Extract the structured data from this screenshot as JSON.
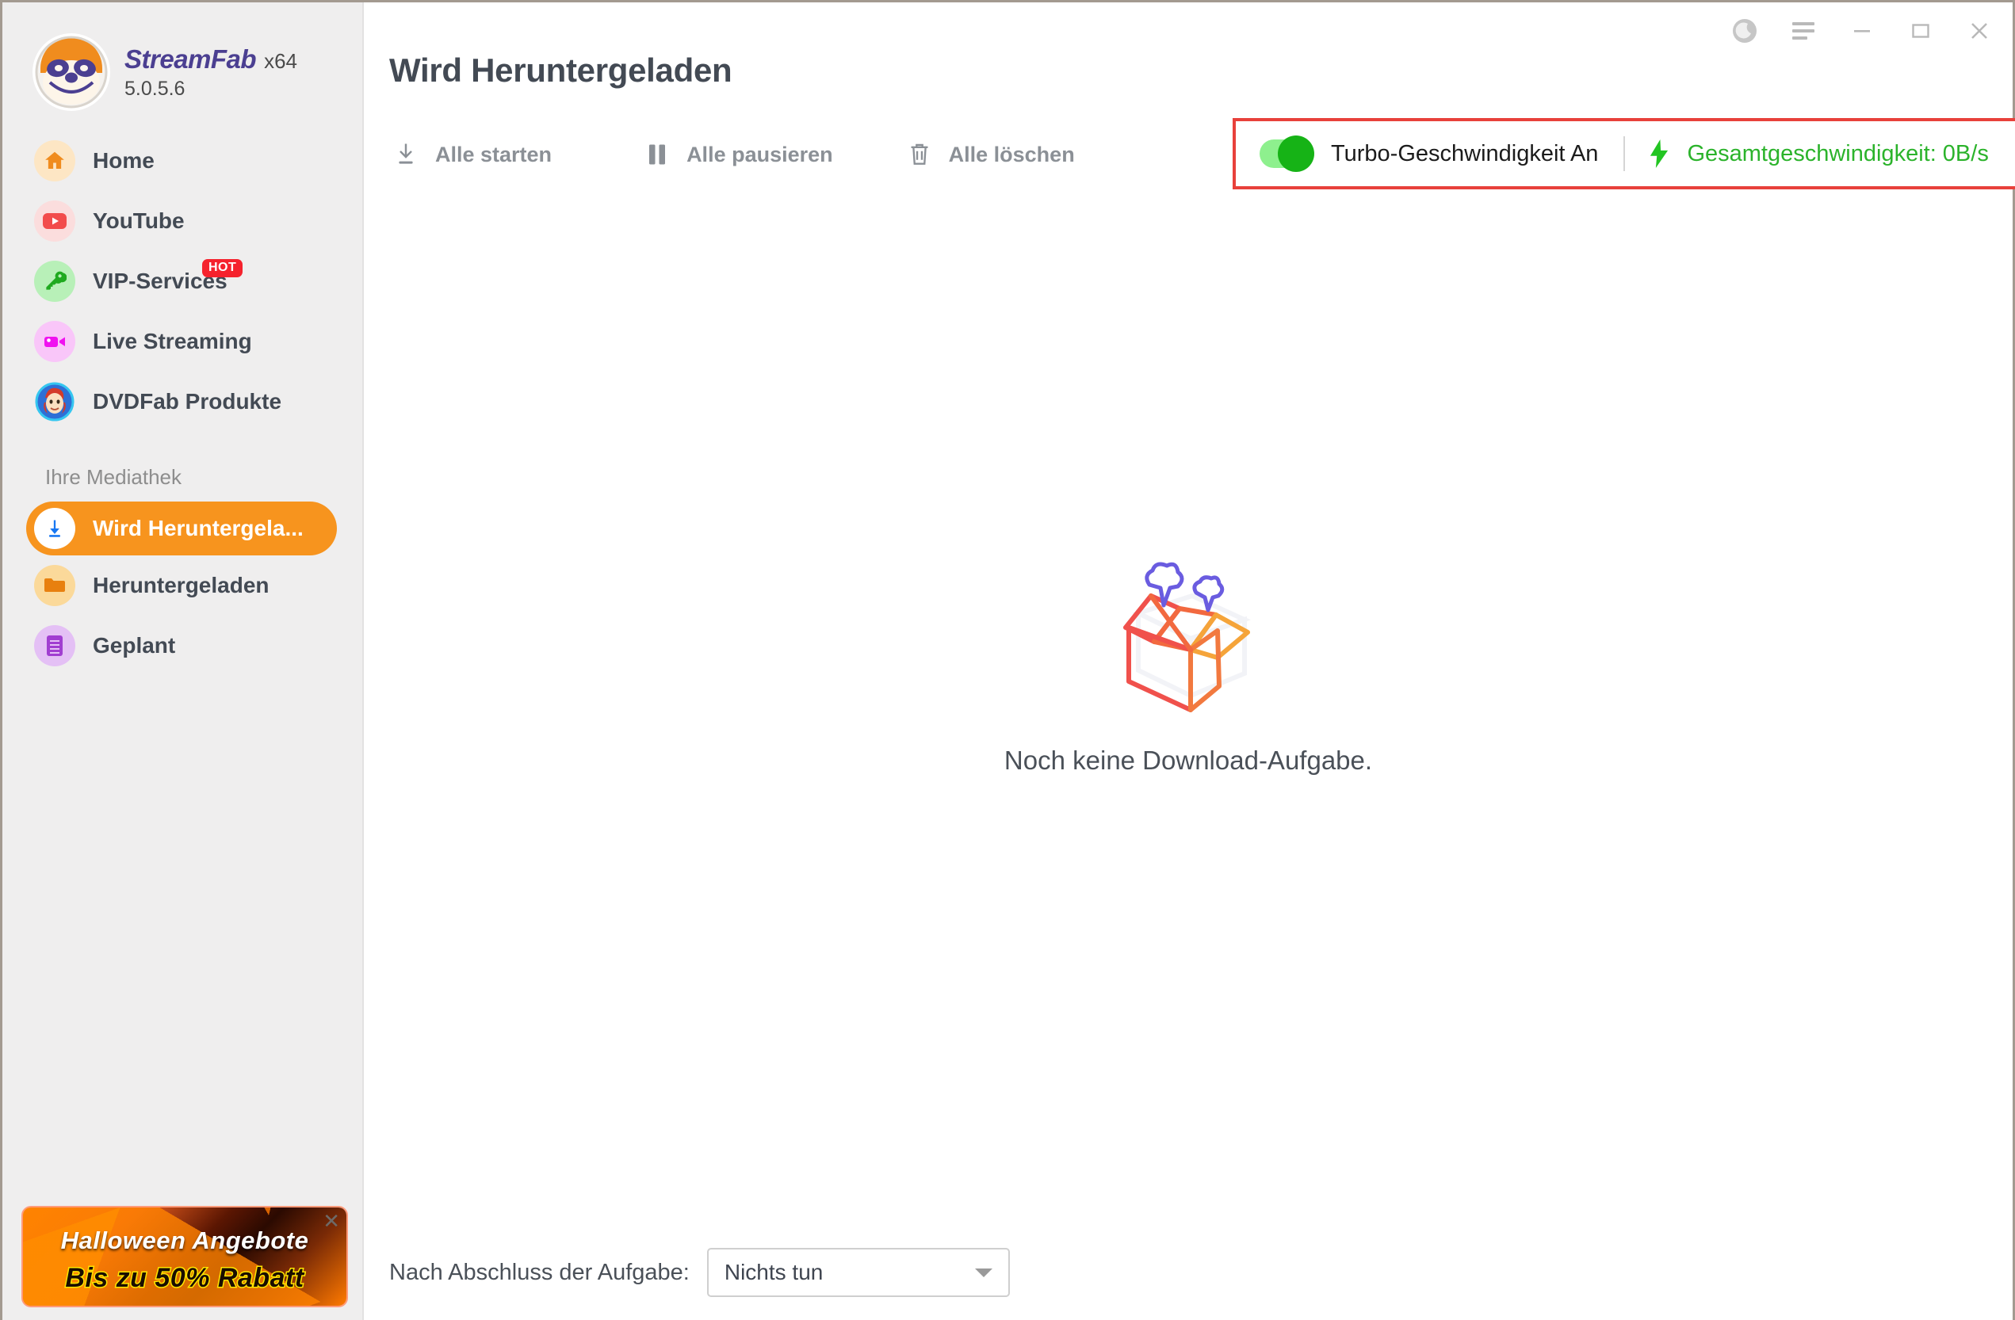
{
  "app": {
    "brand_name": "StreamFab",
    "arch": "x64",
    "version": "5.0.5.6"
  },
  "titlebar": {
    "theme_toggle": "moon-icon",
    "menu": "hamburger-icon",
    "minimize": "minimize-icon",
    "maximize": "maximize-icon",
    "close": "close-icon"
  },
  "sidebar": {
    "items": [
      {
        "label": "Home",
        "icon": "home-icon",
        "badge": null
      },
      {
        "label": "YouTube",
        "icon": "youtube-icon",
        "badge": null
      },
      {
        "label": "VIP-Services",
        "icon": "key-icon",
        "badge": "HOT"
      },
      {
        "label": "Live Streaming",
        "icon": "video-camera-icon",
        "badge": null
      },
      {
        "label": "DVDFab Produkte",
        "icon": "dvdfab-icon",
        "badge": null
      }
    ],
    "section_title": "Ihre Mediathek",
    "library_items": [
      {
        "label": "Wird Heruntergela...",
        "icon": "download-circle-icon",
        "active": true
      },
      {
        "label": "Heruntergeladen",
        "icon": "folder-icon",
        "active": false
      },
      {
        "label": "Geplant",
        "icon": "schedule-list-icon",
        "active": false
      }
    ],
    "promo": {
      "line1": "Halloween Angebote",
      "line2": "Bis zu 50% Rabatt",
      "close": "✕"
    }
  },
  "main": {
    "page_title": "Wird Heruntergeladen",
    "toolbar": {
      "start_all": "Alle starten",
      "pause_all": "Alle pausieren",
      "delete_all": "Alle löschen"
    },
    "turbo": {
      "toggle_state": "on",
      "label": "Turbo-Geschwindigkeit An",
      "speed_label": "Gesamtgeschwindigkeit: 0B/s",
      "highlight_color": "#e8413b",
      "accent_color": "#2bb32b"
    },
    "empty": {
      "text": "Noch keine Download-Aufgabe.",
      "icon": "empty-box-icon"
    },
    "bottom": {
      "label": "Nach Abschluss der Aufgabe:",
      "select_value": "Nichts tun"
    }
  }
}
